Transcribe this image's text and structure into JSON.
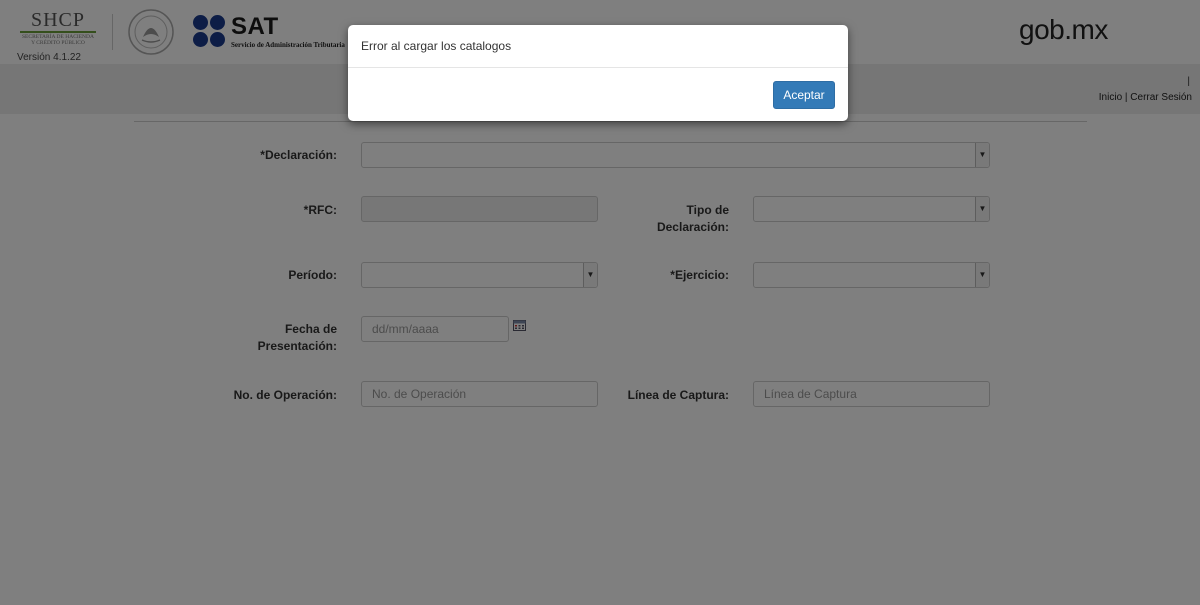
{
  "header": {
    "shcp_title": "SHCP",
    "shcp_sub1": "SECRETARÍA DE HACIENDA",
    "shcp_sub2": "Y CRÉDITO PÚBLICO",
    "version": "Versión 4.1.22",
    "sat_word": "SAT",
    "sat_sub": "Servicio de Administración Tributaria",
    "gobmx": "gob.mx"
  },
  "nav": {
    "separator_top": "|",
    "inicio": "Inicio",
    "separator": " | ",
    "cerrar_sesion": "Cerrar Sesión"
  },
  "form": {
    "declaracion_label": "*Declaración:",
    "rfc_label": "*RFC:",
    "tipo_label_1": "Tipo de",
    "tipo_label_2": "Declaración:",
    "periodo_label": "Período:",
    "ejercicio_label": "*Ejercicio:",
    "fecha_label_1": "Fecha de",
    "fecha_label_2": "Presentación:",
    "fecha_placeholder": "dd/mm/aaaa",
    "operacion_label": "No. de Operación:",
    "operacion_placeholder": "No. de Operación",
    "linea_label": "Línea de Captura:",
    "linea_placeholder": "Línea de Captura"
  },
  "modal": {
    "title": "Error al cargar los catalogos",
    "button": "Aceptar"
  },
  "colors": {
    "primary_button": "#337ab7",
    "sat_blue": "#1b3b8c",
    "shcp_green": "#6b9e3a"
  },
  "icons": {
    "dropdown": "chevron-down-icon",
    "calendar": "calendar-icon"
  }
}
